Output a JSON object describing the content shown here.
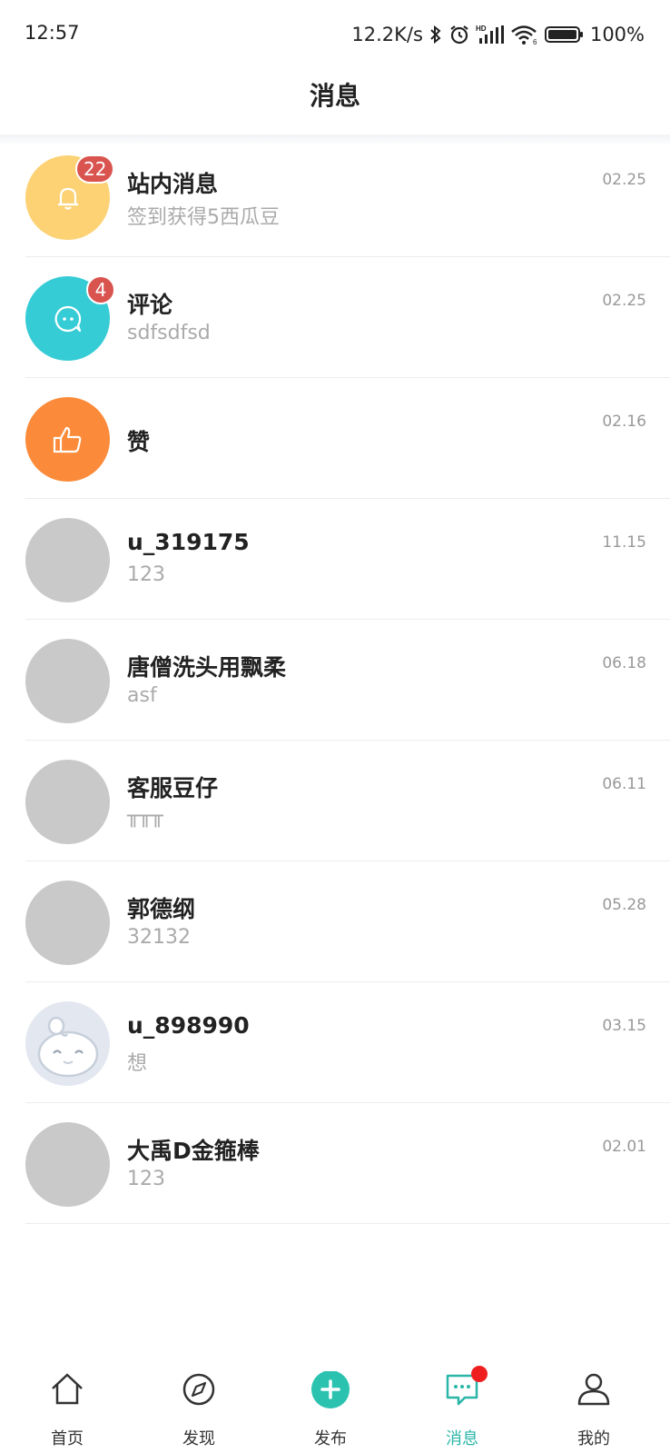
{
  "status_bar": {
    "time": "12:57",
    "speed": "12.2K/s",
    "battery": "100%",
    "icons": [
      "bluetooth-icon",
      "alarm-icon",
      "signal-icon",
      "wifi-icon",
      "battery-icon"
    ]
  },
  "header": {
    "title": "消息"
  },
  "messages": [
    {
      "name": "站内消息",
      "preview": "签到获得5西瓜豆",
      "date": "02.25",
      "badge": "22",
      "avatar_color": "#fcd275",
      "icon": "bell-icon"
    },
    {
      "name": "评论",
      "preview": "sdfsdfsd",
      "date": "02.25",
      "badge": "4",
      "avatar_color": "#36ccd6",
      "icon": "comment-icon"
    },
    {
      "name": "赞",
      "preview": "",
      "date": "02.16",
      "badge": "",
      "avatar_color": "#fb8b3a",
      "icon": "thumbs-up-icon"
    },
    {
      "name": "u_319175",
      "preview": "123",
      "date": "11.15",
      "badge": "",
      "avatar_color": "#c9c9c9",
      "icon": ""
    },
    {
      "name": "唐僧洗头用飘柔",
      "preview": "asf",
      "date": "06.18",
      "badge": "",
      "avatar_color": "#c9c9c9",
      "icon": ""
    },
    {
      "name": "客服豆仔",
      "preview": "╥╥╥",
      "date": "06.11",
      "badge": "",
      "avatar_color": "#c9c9c9",
      "icon": ""
    },
    {
      "name": "郭德纲",
      "preview": "32132",
      "date": "05.28",
      "badge": "",
      "avatar_color": "#c9c9c9",
      "icon": ""
    },
    {
      "name": "u_898990",
      "preview": "想",
      "date": "03.15",
      "badge": "",
      "avatar_color": "#e3e8f0",
      "icon": "bean-mascot-icon"
    },
    {
      "name": "大禹D金箍棒",
      "preview": "123",
      "date": "02.01",
      "badge": "",
      "avatar_color": "#c9c9c9",
      "icon": ""
    }
  ],
  "tabs": [
    {
      "label": "首页",
      "icon": "home-icon",
      "active": false
    },
    {
      "label": "发现",
      "icon": "discover-icon",
      "active": false
    },
    {
      "label": "发布",
      "icon": "publish-plus-icon",
      "active": false
    },
    {
      "label": "消息",
      "icon": "message-icon",
      "active": true
    },
    {
      "label": "我的",
      "icon": "profile-icon",
      "active": false
    }
  ],
  "colors": {
    "accent": "#2bb6a8",
    "badge": "#d9534f",
    "notify_dot": "#f01f1f"
  }
}
